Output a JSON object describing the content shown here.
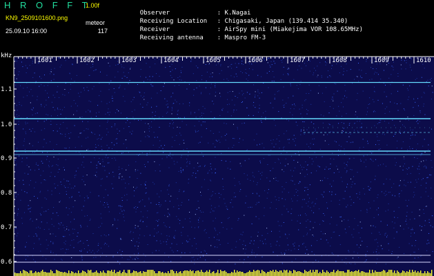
{
  "header": {
    "app_title": "H R O F F T",
    "version": "1.00f",
    "file_name": "KN9_2509101600.png",
    "meteor_label": "meteor",
    "datetime": "25.09.10 16:00",
    "meteor_count": "117"
  },
  "info": [
    {
      "label": "Observer",
      "value": ": K.Nagai"
    },
    {
      "label": "Receiving Location",
      "value": ": Chigasaki, Japan (139.414 35.340)"
    },
    {
      "label": "Receiver",
      "value": ": AirSpy mini (Miakejima VOR 108.65MHz)"
    },
    {
      "label": "Receiving antenna",
      "value": ": Maspro FM-3"
    }
  ],
  "plot": {
    "y_unit": "kHz",
    "y_ticks": [
      "1.1",
      "1.0",
      "0.9",
      "0.8",
      "0.7",
      "0.6"
    ],
    "x_ticks": [
      "1601",
      "1602",
      "1603",
      "1604",
      "1605",
      "1606",
      "1607",
      "1608",
      "1609",
      "1610"
    ],
    "colors": {
      "background": "#0c0c4a",
      "noise_dot": "#3a66ff",
      "trace": "#66ddff",
      "baseline": "#ffff33",
      "axis": "#ffffff"
    }
  }
}
